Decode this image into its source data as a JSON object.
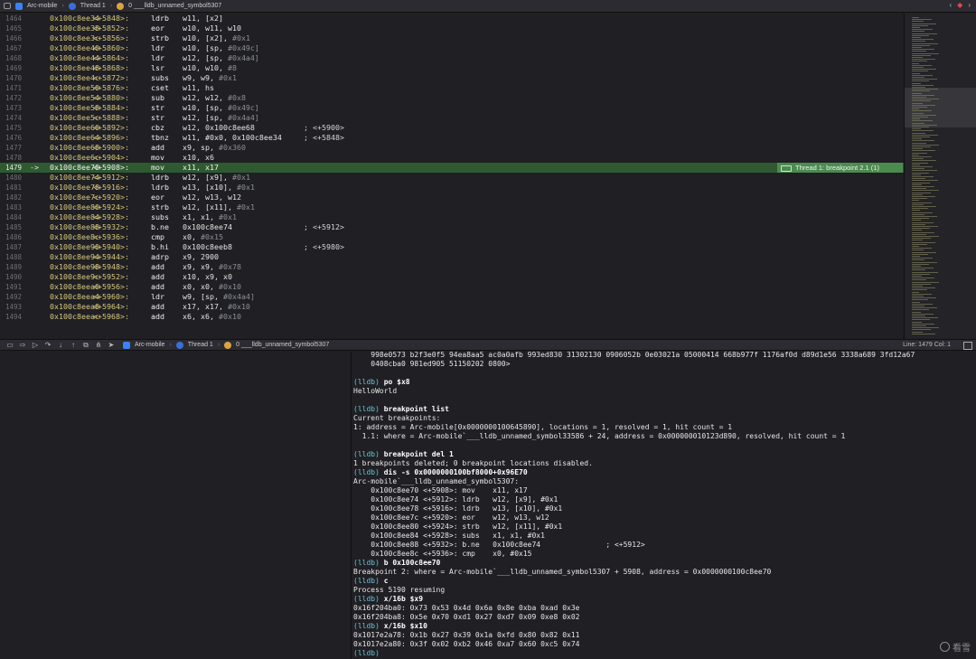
{
  "jumpbar": {
    "crumbs": [
      "Arc-mobile",
      "Thread 1",
      "0 ___lldb_unnamed_symbol5307"
    ],
    "right_icons": [
      "chevron-left-icon",
      "warning-icon",
      "chevron-right-icon"
    ]
  },
  "editor": {
    "lines": [
      {
        "ln": "1464",
        "addr": "0x100c8ee34",
        "off": "<+5848>:",
        "mnem": "ldrb",
        "ops": "w11, [x2]",
        "imm": "",
        "cmt": ""
      },
      {
        "ln": "1465",
        "addr": "0x100c8ee38",
        "off": "<+5852>:",
        "mnem": "eor",
        "ops": "w10, w11, w10",
        "imm": "",
        "cmt": ""
      },
      {
        "ln": "1466",
        "addr": "0x100c8ee3c",
        "off": "<+5856>:",
        "mnem": "strb",
        "ops": "w10, [x2], ",
        "imm": "#0x1",
        "cmt": ""
      },
      {
        "ln": "1467",
        "addr": "0x100c8ee40",
        "off": "<+5860>:",
        "mnem": "ldr",
        "ops": "w10, [sp, ",
        "imm": "#0x49c]",
        "cmt": ""
      },
      {
        "ln": "1468",
        "addr": "0x100c8ee44",
        "off": "<+5864>:",
        "mnem": "ldr",
        "ops": "w12, [sp, ",
        "imm": "#0x4a4]",
        "cmt": ""
      },
      {
        "ln": "1469",
        "addr": "0x100c8ee48",
        "off": "<+5868>:",
        "mnem": "lsr",
        "ops": "w10, w10, ",
        "imm": "#8",
        "cmt": ""
      },
      {
        "ln": "1470",
        "addr": "0x100c8ee4c",
        "off": "<+5872>:",
        "mnem": "subs",
        "ops": "w9, w9, ",
        "imm": "#0x1",
        "cmt": ""
      },
      {
        "ln": "1471",
        "addr": "0x100c8ee50",
        "off": "<+5876>:",
        "mnem": "cset",
        "ops": "w11, hs",
        "imm": "",
        "cmt": ""
      },
      {
        "ln": "1472",
        "addr": "0x100c8ee54",
        "off": "<+5880>:",
        "mnem": "sub",
        "ops": "w12, w12, ",
        "imm": "#0x8",
        "cmt": ""
      },
      {
        "ln": "1473",
        "addr": "0x100c8ee58",
        "off": "<+5884>:",
        "mnem": "str",
        "ops": "w10, [sp, ",
        "imm": "#0x49c]",
        "cmt": ""
      },
      {
        "ln": "1474",
        "addr": "0x100c8ee5c",
        "off": "<+5888>:",
        "mnem": "str",
        "ops": "w12, [sp, ",
        "imm": "#0x4a4]",
        "cmt": ""
      },
      {
        "ln": "1475",
        "addr": "0x100c8ee60",
        "off": "<+5892>:",
        "mnem": "cbz",
        "ops": "w12, 0x100c8ee68",
        "imm": "",
        "cmt": "; <+5900>"
      },
      {
        "ln": "1476",
        "addr": "0x100c8ee64",
        "off": "<+5896>:",
        "mnem": "tbnz",
        "ops": "w11, #0x0, 0x100c8ee34",
        "imm": "",
        "cmt": "; <+5848>"
      },
      {
        "ln": "1477",
        "addr": "0x100c8ee68",
        "off": "<+5900>:",
        "mnem": "add",
        "ops": "x9, sp, ",
        "imm": "#0x360",
        "cmt": ""
      },
      {
        "ln": "1478",
        "addr": "0x100c8ee6c",
        "off": "<+5904>:",
        "mnem": "mov",
        "ops": "x10, x6",
        "imm": "",
        "cmt": ""
      },
      {
        "ln": "1479",
        "addr": "0x100c8ee70",
        "off": "<+5908>:",
        "mnem": "mov",
        "ops": "x11, x17",
        "imm": "",
        "cmt": "",
        "current": true,
        "arrow": "->"
      },
      {
        "ln": "1480",
        "addr": "0x100c8ee74",
        "off": "<+5912>:",
        "mnem": "ldrb",
        "ops": "w12, [x9], ",
        "imm": "#0x1",
        "cmt": ""
      },
      {
        "ln": "1481",
        "addr": "0x100c8ee78",
        "off": "<+5916>:",
        "mnem": "ldrb",
        "ops": "w13, [x10], ",
        "imm": "#0x1",
        "cmt": ""
      },
      {
        "ln": "1482",
        "addr": "0x100c8ee7c",
        "off": "<+5920>:",
        "mnem": "eor",
        "ops": "w12, w13, w12",
        "imm": "",
        "cmt": ""
      },
      {
        "ln": "1483",
        "addr": "0x100c8ee80",
        "off": "<+5924>:",
        "mnem": "strb",
        "ops": "w12, [x11], ",
        "imm": "#0x1",
        "cmt": ""
      },
      {
        "ln": "1484",
        "addr": "0x100c8ee84",
        "off": "<+5928>:",
        "mnem": "subs",
        "ops": "x1, x1, ",
        "imm": "#0x1",
        "cmt": ""
      },
      {
        "ln": "1485",
        "addr": "0x100c8ee88",
        "off": "<+5932>:",
        "mnem": "b.ne",
        "ops": "0x100c8ee74",
        "imm": "",
        "cmt": "; <+5912>"
      },
      {
        "ln": "1486",
        "addr": "0x100c8ee8c",
        "off": "<+5936>:",
        "mnem": "cmp",
        "ops": "x0, ",
        "imm": "#0x15",
        "cmt": ""
      },
      {
        "ln": "1487",
        "addr": "0x100c8ee90",
        "off": "<+5940>:",
        "mnem": "b.hi",
        "ops": "0x100c8eeb8",
        "imm": "",
        "cmt": "; <+5980>"
      },
      {
        "ln": "1488",
        "addr": "0x100c8ee94",
        "off": "<+5944>:",
        "mnem": "adrp",
        "ops": "x9, 2900",
        "imm": "",
        "cmt": ""
      },
      {
        "ln": "1489",
        "addr": "0x100c8ee98",
        "off": "<+5948>:",
        "mnem": "add",
        "ops": "x9, x9, ",
        "imm": "#0x78",
        "cmt": ""
      },
      {
        "ln": "1490",
        "addr": "0x100c8ee9c",
        "off": "<+5952>:",
        "mnem": "add",
        "ops": "x10, x9, x0",
        "imm": "",
        "cmt": ""
      },
      {
        "ln": "1491",
        "addr": "0x100c8eea0",
        "off": "<+5956>:",
        "mnem": "add",
        "ops": "x0, x0, ",
        "imm": "#0x10",
        "cmt": ""
      },
      {
        "ln": "1492",
        "addr": "0x100c8eea4",
        "off": "<+5960>:",
        "mnem": "ldr",
        "ops": "w9, [sp, ",
        "imm": "#0x4a4]",
        "cmt": ""
      },
      {
        "ln": "1493",
        "addr": "0x100c8eea8",
        "off": "<+5964>:",
        "mnem": "add",
        "ops": "x17, x17, ",
        "imm": "#0x10",
        "cmt": ""
      },
      {
        "ln": "1494",
        "addr": "0x100c8eeac",
        "off": "<+5968>:",
        "mnem": "add",
        "ops": "x6, x6, ",
        "imm": "#0x10",
        "cmt": ""
      }
    ],
    "breakpoint_badge": "Thread 1: breakpoint 2.1 (1)"
  },
  "debugbar": {
    "buttons": [
      "hide-panel-icon",
      "breakpoints-toggle-icon",
      "continue-icon",
      "step-over-icon",
      "step-into-icon",
      "step-out-icon",
      "view-debugger-icon",
      "memory-graph-icon",
      "location-icon"
    ],
    "crumbs": [
      "Arc-mobile",
      "Thread 1",
      "0 ___lldb_unnamed_symbol5307"
    ],
    "status": "Line: 1479  Col: 1"
  },
  "console": {
    "lines": [
      {
        "t": "out",
        "text": "    998e0573 b2f3e0f5 94ea8aa5 ac0a0afb 993ed830 31302130 0906052b 0e03021a 05000414 668b977f 1176af0d d89d1e56 3338a689 3fd12a67"
      },
      {
        "t": "out",
        "text": "    0408cba0 981ed905 51150202 0800>"
      },
      {
        "t": "blank",
        "text": ""
      },
      {
        "t": "cmd",
        "prompt": "(lldb) ",
        "text": "po $x8"
      },
      {
        "t": "out",
        "text": "HelloWorld"
      },
      {
        "t": "blank",
        "text": ""
      },
      {
        "t": "cmd",
        "prompt": "(lldb) ",
        "text": "breakpoint list"
      },
      {
        "t": "out",
        "text": "Current breakpoints:"
      },
      {
        "t": "out",
        "text": "1: address = Arc-mobile[0x0000000100645890], locations = 1, resolved = 1, hit count = 1"
      },
      {
        "t": "out",
        "text": "  1.1: where = Arc-mobile`___lldb_unnamed_symbol33586 + 24, address = 0x000000010123d890, resolved, hit count = 1"
      },
      {
        "t": "blank",
        "text": ""
      },
      {
        "t": "cmd",
        "prompt": "(lldb) ",
        "text": "breakpoint del 1"
      },
      {
        "t": "out",
        "text": "1 breakpoints deleted; 0 breakpoint locations disabled."
      },
      {
        "t": "cmd",
        "prompt": "(lldb) ",
        "text": "dis -s 0x0000000100bf8000+0x96E70"
      },
      {
        "t": "out",
        "text": "Arc-mobile`___lldb_unnamed_symbol5307:"
      },
      {
        "t": "out",
        "text": "    0x100c8ee70 <+5908>: mov    x11, x17"
      },
      {
        "t": "out",
        "text": "    0x100c8ee74 <+5912>: ldrb   w12, [x9], #0x1"
      },
      {
        "t": "out",
        "text": "    0x100c8ee78 <+5916>: ldrb   w13, [x10], #0x1"
      },
      {
        "t": "out",
        "text": "    0x100c8ee7c <+5920>: eor    w12, w13, w12"
      },
      {
        "t": "out",
        "text": "    0x100c8ee80 <+5924>: strb   w12, [x11], #0x1"
      },
      {
        "t": "out",
        "text": "    0x100c8ee84 <+5928>: subs   x1, x1, #0x1"
      },
      {
        "t": "out",
        "text": "    0x100c8ee88 <+5932>: b.ne   0x100c8ee74               ; <+5912>"
      },
      {
        "t": "out",
        "text": "    0x100c8ee8c <+5936>: cmp    x0, #0x15"
      },
      {
        "t": "cmd",
        "prompt": "(lldb) ",
        "text": "b 0x100c8ee70"
      },
      {
        "t": "out",
        "text": "Breakpoint 2: where = Arc-mobile`___lldb_unnamed_symbol5307 + 5908, address = 0x0000000100c8ee70"
      },
      {
        "t": "cmd",
        "prompt": "(lldb) ",
        "text": "c"
      },
      {
        "t": "out",
        "text": "Process 5190 resuming"
      },
      {
        "t": "cmd",
        "prompt": "(lldb) ",
        "text": "x/16b $x9"
      },
      {
        "t": "out",
        "text": "0x16f204ba0: 0x73 0x53 0x4d 0x6a 0x8e 0xba 0xad 0x3e"
      },
      {
        "t": "out",
        "text": "0x16f204ba8: 0x5e 0x70 0xd1 0x27 0xd7 0x09 0xe8 0x02"
      },
      {
        "t": "cmd",
        "prompt": "(lldb) ",
        "text": "x/16b $x10"
      },
      {
        "t": "out",
        "text": "0x1017e2a78: 0x1b 0x27 0x39 0x1a 0xfd 0x80 0x82 0x11"
      },
      {
        "t": "out",
        "text": "0x1017e2a80: 0x3f 0x02 0xb2 0x46 0xa7 0x60 0xc5 0x74"
      },
      {
        "t": "cmd",
        "prompt": "(lldb) ",
        "text": ""
      }
    ]
  },
  "watermark": {
    "text": "看雪",
    "icon": "snowflake-icon"
  }
}
